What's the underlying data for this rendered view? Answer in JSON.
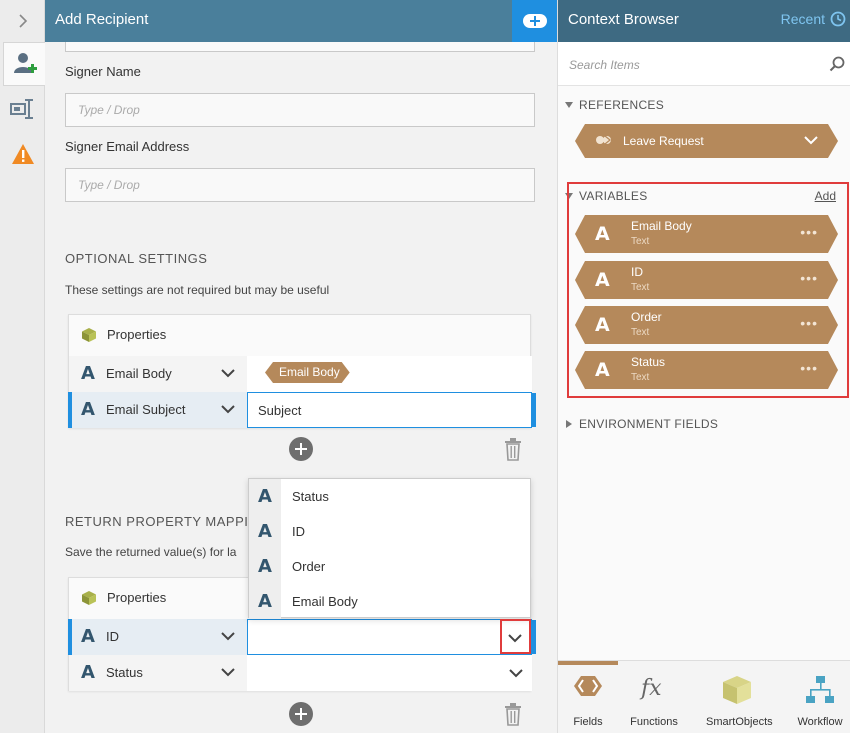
{
  "colors": {
    "header": "#4a7f9b",
    "accent": "#1f8fe0",
    "tag": "#b5895b",
    "highlight": "#e03c3c"
  },
  "main": {
    "title": "Add Recipient",
    "signer_name": {
      "label": "Signer Name",
      "placeholder": "Type / Drop"
    },
    "signer_email": {
      "label": "Signer Email Address",
      "placeholder": "Type / Drop"
    },
    "optional": {
      "title": "OPTIONAL SETTINGS",
      "desc": "These settings are not required but may be useful",
      "properties_label": "Properties",
      "rows": [
        {
          "name": "Email Body",
          "value_tag": "Email Body"
        },
        {
          "name": "Email Subject",
          "value": "Subject"
        }
      ]
    },
    "return": {
      "title": "RETURN PROPERTY MAPPIN",
      "desc": "Save the returned value(s) for la",
      "properties_label": "Properties",
      "rows": [
        {
          "name": "ID",
          "value": ""
        },
        {
          "name": "Status",
          "value": ""
        }
      ]
    },
    "dropdown": [
      "Status",
      "ID",
      "Order",
      "Email Body"
    ]
  },
  "context": {
    "title": "Context Browser",
    "recent": "Recent",
    "search_placeholder": "Search Items",
    "references": {
      "title": "REFERENCES",
      "items": [
        "Leave Request"
      ]
    },
    "variables": {
      "title": "VARIABLES",
      "add": "Add",
      "items": [
        {
          "name": "Email Body",
          "type": "Text"
        },
        {
          "name": "ID",
          "type": "Text"
        },
        {
          "name": "Order",
          "type": "Text"
        },
        {
          "name": "Status",
          "type": "Text"
        }
      ]
    },
    "environment": {
      "title": "ENVIRONMENT FIELDS"
    },
    "tabs": [
      "Fields",
      "Functions",
      "SmartObjects",
      "Workflow"
    ]
  }
}
